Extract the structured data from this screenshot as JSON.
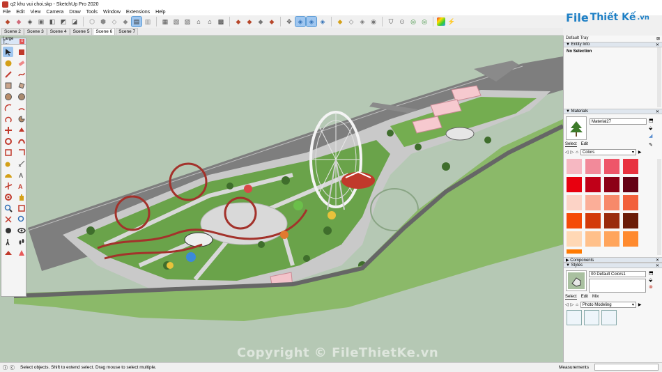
{
  "app": {
    "window_title": "q2 khu vui choi.skp - SketchUp Pro 2020"
  },
  "menu": [
    "File",
    "Edit",
    "View",
    "Camera",
    "Draw",
    "Tools",
    "Window",
    "Extensions",
    "Help"
  ],
  "scene_tabs": [
    {
      "label": "Scene 2",
      "active": false
    },
    {
      "label": "Scene 3",
      "active": false
    },
    {
      "label": "Scene 4",
      "active": false
    },
    {
      "label": "Scene 5",
      "active": false
    },
    {
      "label": "Scene 6",
      "active": true
    },
    {
      "label": "Scene 7",
      "active": false
    }
  ],
  "left_toolbar": {
    "title": "Large T...",
    "close": "x"
  },
  "tray": {
    "title": "Default Tray",
    "entity_info": {
      "header": "Entity Info",
      "selection": "No Selection"
    },
    "materials": {
      "header": "Materials",
      "material_name": "Material27",
      "tabs": [
        "Select",
        "Edit"
      ],
      "library": "Colors",
      "swatches": [
        "#f6b8c2",
        "#f28a9a",
        "#ee5669",
        "#e8323f",
        "#e8000f",
        "#c00018",
        "#8c0016",
        "#640014",
        "#fcd3c6",
        "#fbae98",
        "#f7896a",
        "#f2603b",
        "#f54b08",
        "#d33a0a",
        "#9a2b0c",
        "#6b1c08",
        "#ffd8b5",
        "#ffc08a",
        "#ffa55c",
        "#ff8a2e",
        "#ff7a00"
      ]
    },
    "components": {
      "header": "Components"
    },
    "styles": {
      "header": "Styles",
      "style_name": "00  Default Colors1",
      "tabs": [
        "Select",
        "Edit",
        "Mix"
      ],
      "library": "Photo Modeling"
    }
  },
  "status": {
    "message": "Select objects. Shift to extend select. Drag mouse to select multiple.",
    "measurements_label": "Measurements",
    "measurements_value": ""
  },
  "branding": {
    "logo_text_1": "File",
    "logo_text_2": "Thiết Kế",
    "logo_text_3": ".vn",
    "watermark": "Copyright © FileThietKe.vn"
  },
  "colors": {
    "viewport_bg": "#b5c8b4",
    "road": "#7d7d7d",
    "grass": "#6fa64a",
    "plaza": "#d8d8d8",
    "coaster": "#a8302c",
    "ferris": "#ffffff",
    "building": "#f5c6cc"
  },
  "icons": {
    "select": "arrow-select-icon",
    "eraser": "eraser-icon",
    "paint": "paint-bucket-icon",
    "line": "pencil-line-icon",
    "arc": "arc-icon",
    "rectangle": "rectangle-icon",
    "circle": "circle-icon",
    "polygon": "polygon-icon",
    "freehand": "freehand-icon",
    "move": "move-icon",
    "pushpull": "push-pull-icon",
    "rotate": "rotate-icon",
    "followme": "follow-me-icon",
    "scale": "scale-icon",
    "offset": "offset-icon",
    "tape": "tape-measure-icon",
    "dimension": "dimension-icon",
    "protractor": "protractor-icon",
    "text": "text-icon",
    "axes": "axes-icon",
    "3dtext": "3d-text-icon",
    "orbit": "orbit-icon",
    "pan": "pan-icon",
    "zoom": "zoom-icon",
    "zoomwindow": "zoom-window-icon",
    "zoomextents": "zoom-extents-icon",
    "position_camera": "position-camera-icon",
    "walk": "walk-icon",
    "lookaround": "look-around-icon",
    "section": "section-plane-icon"
  }
}
